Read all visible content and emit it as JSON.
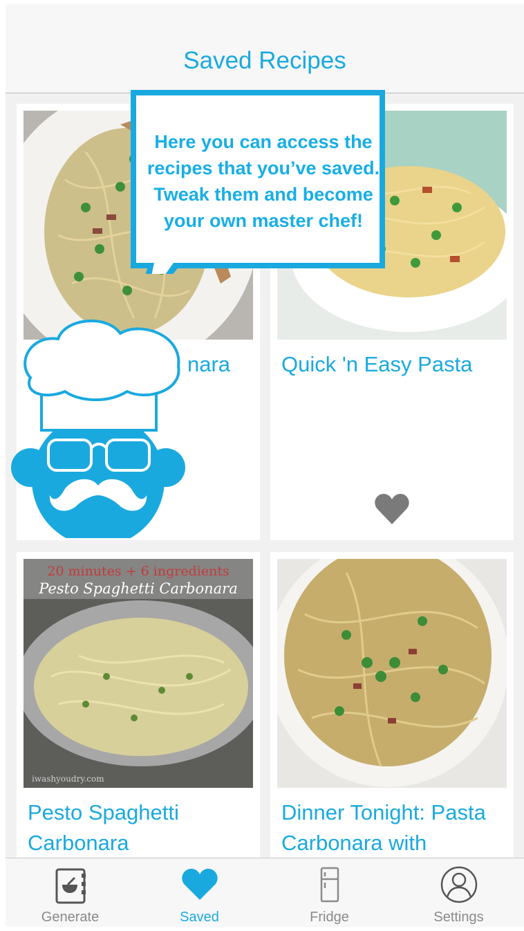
{
  "nav": {
    "title": "Saved Recipes"
  },
  "colors": {
    "accent": "#1aa9df",
    "heart_gray": "#7a7a7a",
    "tab_gray": "#8a8a8a"
  },
  "recipes": [
    {
      "title": "Pasta Carbonara",
      "visible_title": "nara",
      "favorited": false
    },
    {
      "title": "Quick 'n Easy Pasta",
      "favorited": true,
      "favorite_icon": "heart-icon"
    },
    {
      "title": "Pesto Spaghetti Carbonara",
      "photo_caption_top": "20 minutes + 6 ingredients",
      "photo_caption_main": "Pesto Spaghetti Carbonara",
      "photo_watermark": "iwashyoudry.com"
    },
    {
      "title": "Dinner Tonight: Pasta Carbonara with"
    }
  ],
  "tooltip": {
    "text": "Here you can access the recipes that you’ve saved. Tweak them and become your own master chef!",
    "mascot_icon": "chef-mascot-icon"
  },
  "tabbar": {
    "tabs": [
      {
        "label": "Generate",
        "icon": "cookbook-icon",
        "active": false
      },
      {
        "label": "Saved",
        "icon": "heart-icon",
        "active": true
      },
      {
        "label": "Fridge",
        "icon": "fridge-icon",
        "active": false
      },
      {
        "label": "Settings",
        "icon": "user-icon",
        "active": false
      }
    ]
  }
}
